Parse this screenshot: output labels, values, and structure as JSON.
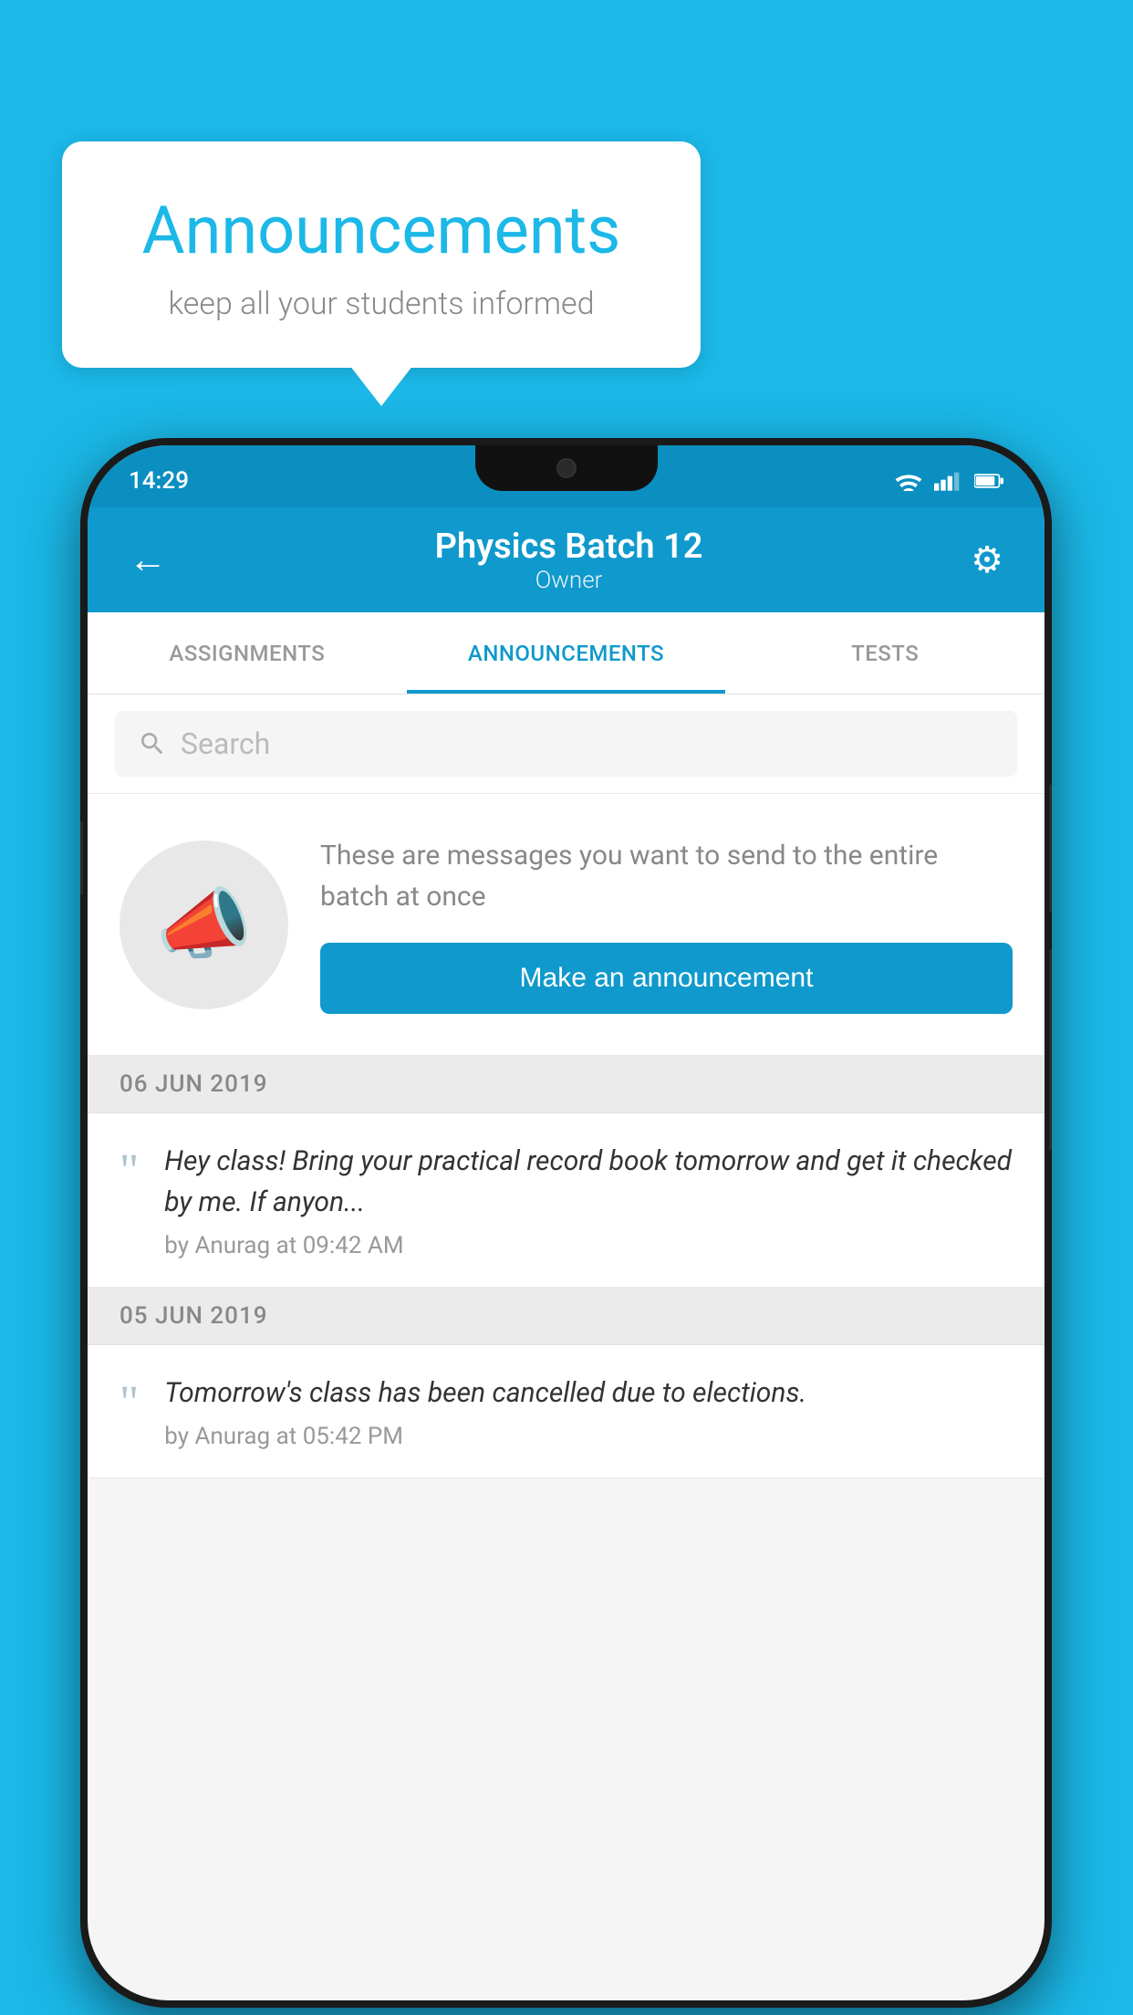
{
  "background_color": "#1BB8E8",
  "speech_bubble": {
    "title": "Announcements",
    "subtitle": "keep all your students informed"
  },
  "phone": {
    "status_bar": {
      "time": "14:29"
    },
    "app_bar": {
      "title": "Physics Batch 12",
      "subtitle": "Owner",
      "back_label": "←",
      "gear_label": "⚙"
    },
    "tabs": [
      {
        "label": "ASSIGNMENTS",
        "active": false
      },
      {
        "label": "ANNOUNCEMENTS",
        "active": true
      },
      {
        "label": "TESTS",
        "active": false
      }
    ],
    "search": {
      "placeholder": "Search"
    },
    "empty_state": {
      "description": "These are messages you want to send to the entire batch at once",
      "button_label": "Make an announcement"
    },
    "announcements": [
      {
        "date": "06  JUN  2019",
        "text": "Hey class! Bring your practical record book tomorrow and get it checked by me. If anyon...",
        "meta": "by Anurag at 09:42 AM"
      },
      {
        "date": "05  JUN  2019",
        "text": "Tomorrow's class has been cancelled due to elections.",
        "meta": "by Anurag at 05:42 PM"
      }
    ]
  }
}
